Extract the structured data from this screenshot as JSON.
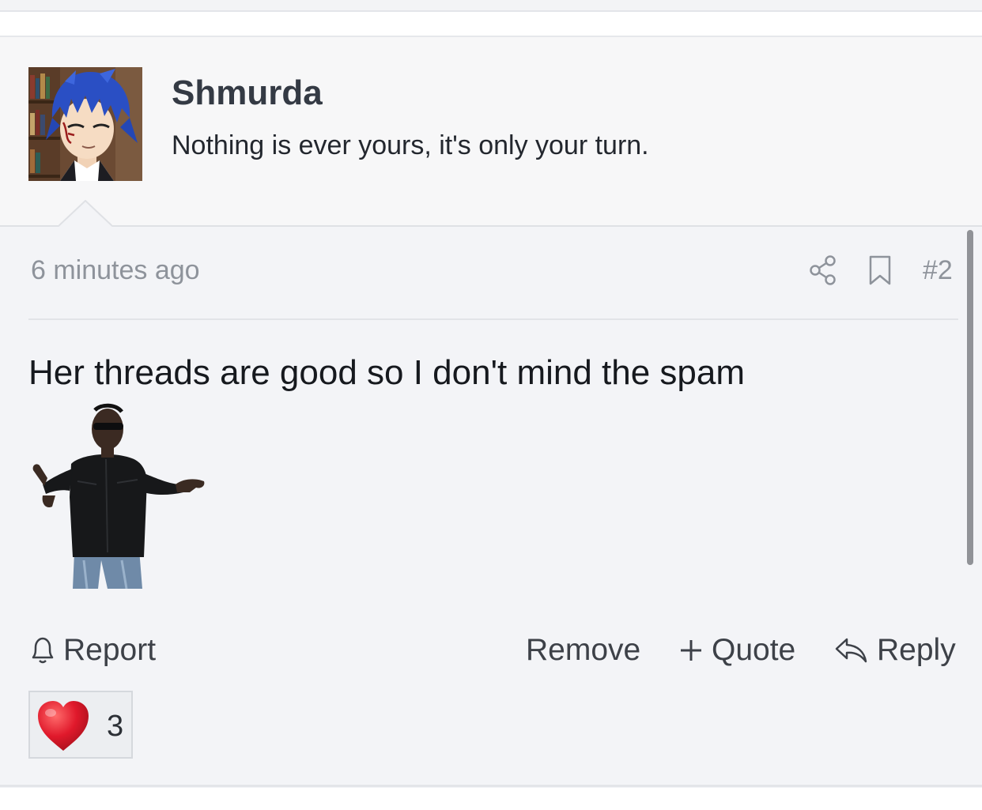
{
  "author": {
    "name": "Shmurda",
    "signature": "Nothing is ever yours, it's only your turn.",
    "avatar_icon": "anime-avatar"
  },
  "post": {
    "timestamp": "6 minutes ago",
    "number": "#2",
    "text": "Her threads are good so I don't mind the spam",
    "image_icon": "shrugging-man-gif",
    "share_icon": "share-icon",
    "bookmark_icon": "bookmark-icon"
  },
  "actions": {
    "report_label": "Report",
    "remove_label": "Remove",
    "quote_label": "Quote",
    "reply_label": "Reply"
  },
  "reaction": {
    "icon": "heart-icon",
    "count": "3",
    "color": "#e0192b"
  },
  "colors": {
    "author_card_bg": "#f7f7f8",
    "post_bg": "#f3f4f7",
    "muted_text": "#8e939b"
  }
}
